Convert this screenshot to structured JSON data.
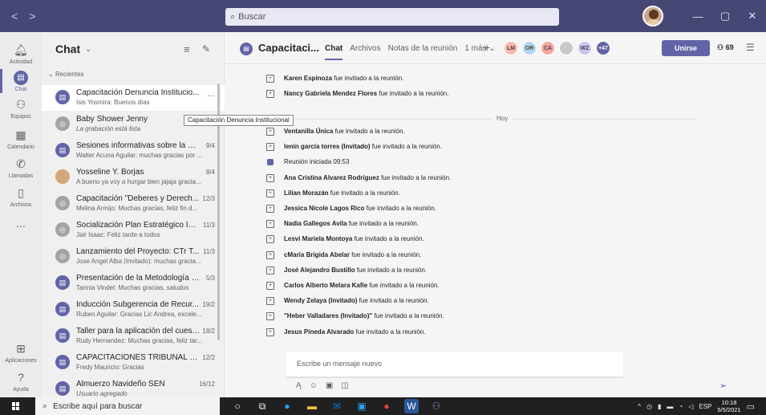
{
  "search": {
    "placeholder": "Buscar"
  },
  "rail": [
    {
      "label": "Actividad",
      "icon": "bell-icon"
    },
    {
      "label": "Chat",
      "icon": "chat-icon"
    },
    {
      "label": "Equipos",
      "icon": "teams-icon"
    },
    {
      "label": "Calendario",
      "icon": "calendar-icon"
    },
    {
      "label": "Llamadas",
      "icon": "phone-icon"
    },
    {
      "label": "Archivos",
      "icon": "file-icon"
    },
    {
      "label": "...",
      "icon": "more-icon"
    },
    {
      "label": "Aplicaciones",
      "icon": "apps-icon"
    },
    {
      "label": "Ayuda",
      "icon": "help-icon"
    }
  ],
  "chatlist": {
    "title": "Chat",
    "section": "Recientes",
    "items": [
      {
        "name": "Capacitación Denuncia Institucio...",
        "preview": "Isis Yosmira: Buenos días",
        "date": ""
      },
      {
        "name": "Baby Shower Jenny",
        "preview": "La grabación está lista",
        "date": ""
      },
      {
        "name": "Sesiones informativas sobre la Pol...",
        "preview": "Walter Acuna Aguilar: muchas gracias por ...",
        "date": "9/4"
      },
      {
        "name": "Yosseline Y. Borjas",
        "preview": "A bueno ya voy a hurgar bien jajaja gracia...",
        "date": "8/4"
      },
      {
        "name": "Capacitación \"Deberes y Derech...",
        "preview": "Melina Armijo: Muchas gracias, feliz fin d...",
        "date": "12/3"
      },
      {
        "name": "Socialización Plan Estratégico Ins...",
        "preview": "Jair Isaac: Feliz tarde a todos",
        "date": "11/3"
      },
      {
        "name": "Lanzamiento del Proyecto: CTr T...",
        "preview": "Jose Angel Alba (Invitado): muchas gracia...",
        "date": "11/3"
      },
      {
        "name": "Presentación de la Metodología d...",
        "preview": "Tannia Vindel: Muchas gracias, saludos",
        "date": "5/3"
      },
      {
        "name": "Inducción Subgerencia de Recur...",
        "preview": "Ruben Aguilar: Gracias Lic Andrea, excele...",
        "date": "19/2"
      },
      {
        "name": "Taller para la aplicación del cuest...",
        "preview": "Rudy Hernandez: Muchas gracias, feliz tar...",
        "date": "18/2"
      },
      {
        "name": "CAPACITACIONES TRIBUNAL SU...",
        "preview": "Fredy Mauricio: Gracias",
        "date": "12/2"
      },
      {
        "name": "Almuerzo Navideño SEN",
        "preview": "Usuario agregado",
        "date": "16/12"
      }
    ]
  },
  "tooltip": "Capacitación Denuncia Institucional",
  "meeting": {
    "title": "Capacitaci...",
    "tabs": [
      "Chat",
      "Archivos",
      "Notas de la reunión",
      "1 más ⌄"
    ],
    "participants": [
      {
        "initials": "LM",
        "color": "#f7b9b0"
      },
      {
        "initials": "OR",
        "color": "#b4d3ec"
      },
      {
        "initials": "CA",
        "color": "#f4a6a0"
      },
      {
        "initials": "",
        "color": "#c8c8c8"
      },
      {
        "initials": "WZ",
        "color": "#c9c4ef"
      },
      {
        "initials": "+47",
        "color": "#6264a7"
      }
    ],
    "join_label": "Unirse",
    "people_count": "69"
  },
  "messages_before": [
    {
      "name": "Karen Espinoza",
      "text": " fue invitado a la reunión."
    },
    {
      "name": "Nancy Gabriela Mendez Flores",
      "text": " fue invitado a la reunión."
    }
  ],
  "day_label": "Hoy",
  "messages_after": [
    {
      "name": "Ventanilla Única",
      "text": " fue invitado a la reunión.",
      "type": "invite"
    },
    {
      "name": "lenin garcía torres (Invitado)",
      "text": " fue invitado a la reunión.",
      "type": "invite"
    },
    {
      "name": "",
      "text": "Reunión iniciada   09:53",
      "type": "meeting"
    },
    {
      "name": "Ana Cristina Alvarez Rodriguez",
      "text": " fue invitado a la reunión.",
      "type": "invite"
    },
    {
      "name": "Lilian Morazán",
      "text": " fue invitado a la reunión.",
      "type": "invite"
    },
    {
      "name": "Jessica Nicole Lagos Rico",
      "text": " fue invitado a la reunión.",
      "type": "invite"
    },
    {
      "name": "Nadia Gallegos Avila",
      "text": " fue invitado a la reunión.",
      "type": "invite"
    },
    {
      "name": "Lesvi Mariela Montoya",
      "text": " fue invitado a la reunión.",
      "type": "invite"
    },
    {
      "name": "cMaria Brigida Abelar",
      "text": " fue invitado a la reunión.",
      "type": "invite"
    },
    {
      "name": "José Alejandro Bustillo",
      "text": " fue invitado a la reunión.",
      "type": "invite"
    },
    {
      "name": "Carlos Alberto Melara Kafie",
      "text": " fue invitado a la reunión.",
      "type": "invite"
    },
    {
      "name": "Wendy Zelaya (Invitado)",
      "text": " fue invitado a la reunión.",
      "type": "invite"
    },
    {
      "name": "\"Heber Valladares (Invitado)\"",
      "text": " fue invitado a la reunión.",
      "type": "invite"
    },
    {
      "name": "Jesus Pineda Alvarado",
      "text": " fue invitado a la reunión.",
      "type": "invite"
    }
  ],
  "composer": {
    "placeholder": "Escribe un mensaje nuevo"
  },
  "taskbar": {
    "search_placeholder": "Escribe aquí para buscar",
    "lang": "ESP",
    "time": "10:18",
    "date": "5/5/2021"
  }
}
